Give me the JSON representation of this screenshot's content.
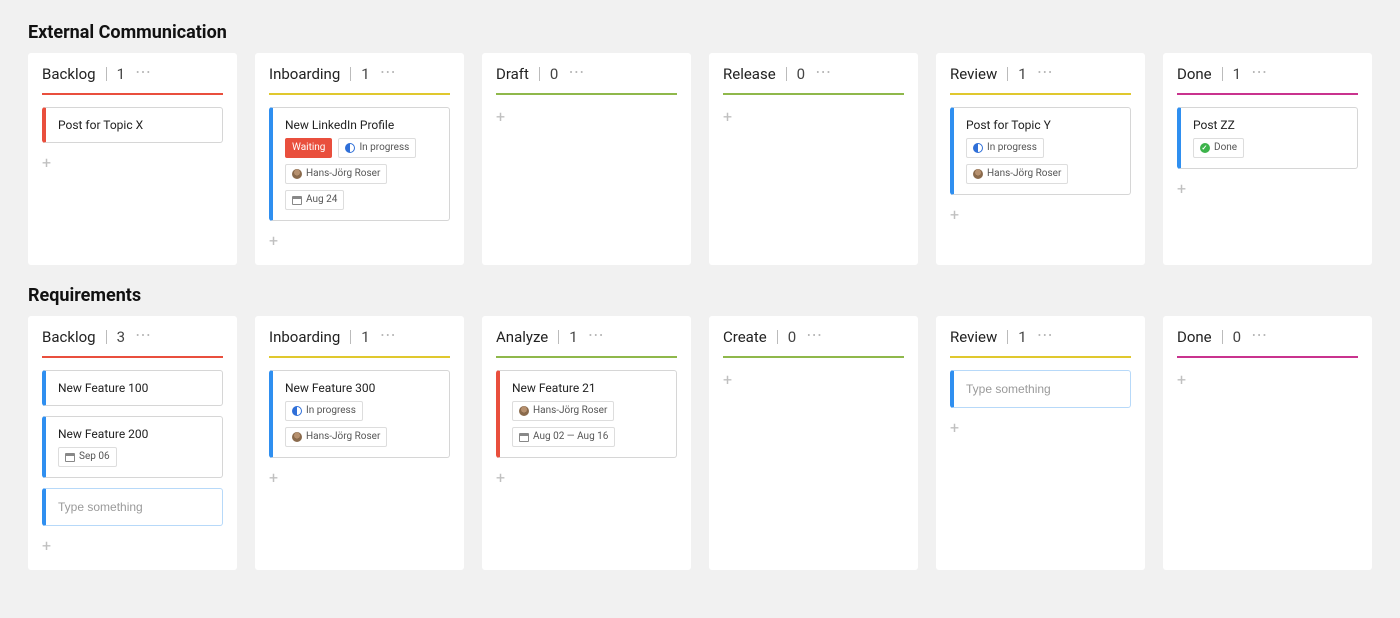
{
  "placeholder_text": "Type something",
  "icons": {
    "ellipsis_label": "column-menu"
  },
  "tag_labels": {
    "waiting": "Waiting",
    "in_progress": "In progress",
    "done": "Done"
  },
  "boards": [
    {
      "title": "External Communication",
      "columns": [
        {
          "name": "Backlog",
          "count": 1,
          "color": "#e94f3d",
          "cards": [
            {
              "title": "Post for Topic X",
              "accent": "red",
              "tags": []
            }
          ]
        },
        {
          "name": "Inboarding",
          "count": 1,
          "color": "#e0c82e",
          "cards": [
            {
              "title": "New LinkedIn Profile",
              "accent": "blue",
              "tags": [
                {
                  "type": "filled-red",
                  "text": "Waiting"
                },
                {
                  "type": "progress",
                  "text": "In progress"
                },
                {
                  "type": "avatar",
                  "text": "Hans-Jörg Roser"
                },
                {
                  "type": "cal",
                  "text": "Aug 24"
                }
              ]
            }
          ]
        },
        {
          "name": "Draft",
          "count": 0,
          "color": "#8fb84b",
          "cards": []
        },
        {
          "name": "Release",
          "count": 0,
          "color": "#8fb84b",
          "cards": []
        },
        {
          "name": "Review",
          "count": 1,
          "color": "#e0c82e",
          "cards": [
            {
              "title": "Post for Topic Y",
              "accent": "blue",
              "tags": [
                {
                  "type": "progress",
                  "text": "In progress"
                },
                {
                  "type": "avatar",
                  "text": "Hans-Jörg Roser"
                }
              ]
            }
          ]
        },
        {
          "name": "Done",
          "count": 1,
          "color": "#c9338e",
          "cards": [
            {
              "title": "Post ZZ",
              "accent": "blue",
              "tags": [
                {
                  "type": "done",
                  "text": "Done"
                }
              ]
            }
          ]
        }
      ]
    },
    {
      "title": "Requirements",
      "columns": [
        {
          "name": "Backlog",
          "count": 3,
          "color": "#e94f3d",
          "cards": [
            {
              "title": "New Feature 100",
              "accent": "blue",
              "tags": []
            },
            {
              "title": "New Feature 200",
              "accent": "blue",
              "tags": [
                {
                  "type": "cal",
                  "text": "Sep 06"
                }
              ]
            }
          ],
          "has_input": true
        },
        {
          "name": "Inboarding",
          "count": 1,
          "color": "#e0c82e",
          "cards": [
            {
              "title": "New Feature 300",
              "accent": "blue",
              "tags": [
                {
                  "type": "progress",
                  "text": "In progress"
                },
                {
                  "type": "avatar",
                  "text": "Hans-Jörg Roser"
                }
              ]
            }
          ]
        },
        {
          "name": "Analyze",
          "count": 1,
          "color": "#8fb84b",
          "cards": [
            {
              "title": "New Feature 21",
              "accent": "red",
              "tags": [
                {
                  "type": "avatar",
                  "text": "Hans-Jörg Roser"
                },
                {
                  "type": "cal",
                  "text": "Aug 02 — Aug 16"
                }
              ]
            }
          ]
        },
        {
          "name": "Create",
          "count": 0,
          "color": "#8fb84b",
          "cards": []
        },
        {
          "name": "Review",
          "count": 1,
          "color": "#e0c82e",
          "cards": [],
          "has_input": true
        },
        {
          "name": "Done",
          "count": 0,
          "color": "#c9338e",
          "cards": []
        }
      ]
    }
  ]
}
